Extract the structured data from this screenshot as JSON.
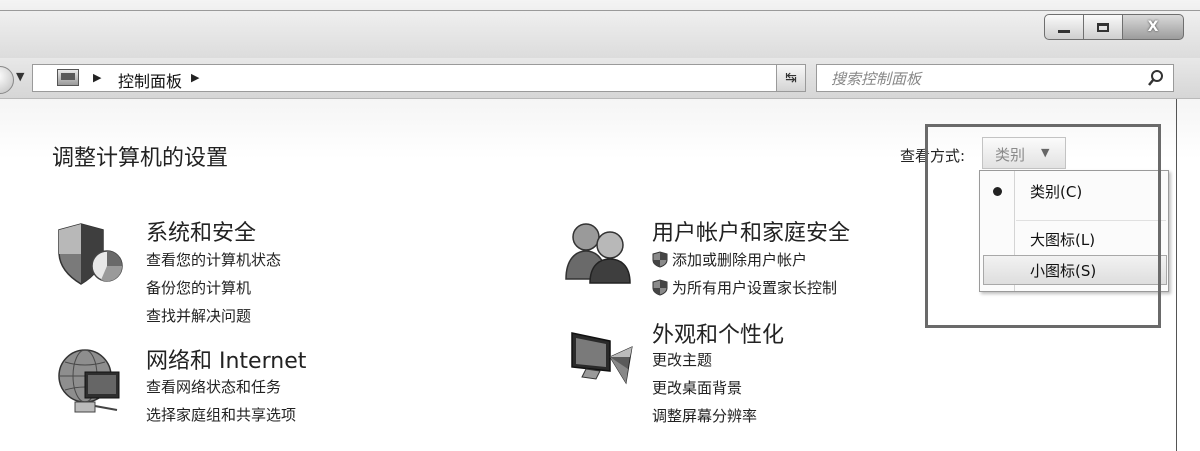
{
  "window": {
    "controls": {
      "minimize_icon": "minimize-icon",
      "maximize_icon": "maximize-icon",
      "close_label": "X"
    }
  },
  "navbar": {
    "breadcrumb": {
      "root_icon": "control-panel-icon",
      "item": "控制面板"
    },
    "search": {
      "placeholder": "搜索控制面板",
      "icon": "search-icon"
    },
    "refresh_icon": "refresh-icon"
  },
  "page": {
    "title": "调整计算机的设置",
    "view_by": {
      "label": "查看方式:",
      "selected": "类别"
    }
  },
  "view_menu": {
    "items": [
      {
        "label": "类别(C)",
        "checked": true
      },
      {
        "label": "大图标(L)",
        "checked": false
      },
      {
        "label": "小图标(S)",
        "checked": false,
        "hovered": true
      }
    ]
  },
  "categories": {
    "system_security": {
      "title": "系统和安全",
      "icon": "shield-icon",
      "links": [
        "查看您的计算机状态",
        "备份您的计算机",
        "查找并解决问题"
      ]
    },
    "network": {
      "title": "网络和 Internet",
      "icon": "network-globe-icon",
      "links": [
        "查看网络状态和任务",
        "选择家庭组和共享选项"
      ]
    },
    "user_accounts": {
      "title": "用户帐户和家庭安全",
      "icon": "users-icon",
      "links": [
        "添加或删除用户帐户",
        "为所有用户设置家长控制"
      ]
    },
    "appearance": {
      "title": "外观和个性化",
      "icon": "monitor-personalize-icon",
      "links": [
        "更改主题",
        "更改桌面背景",
        "调整屏幕分辨率"
      ]
    }
  }
}
